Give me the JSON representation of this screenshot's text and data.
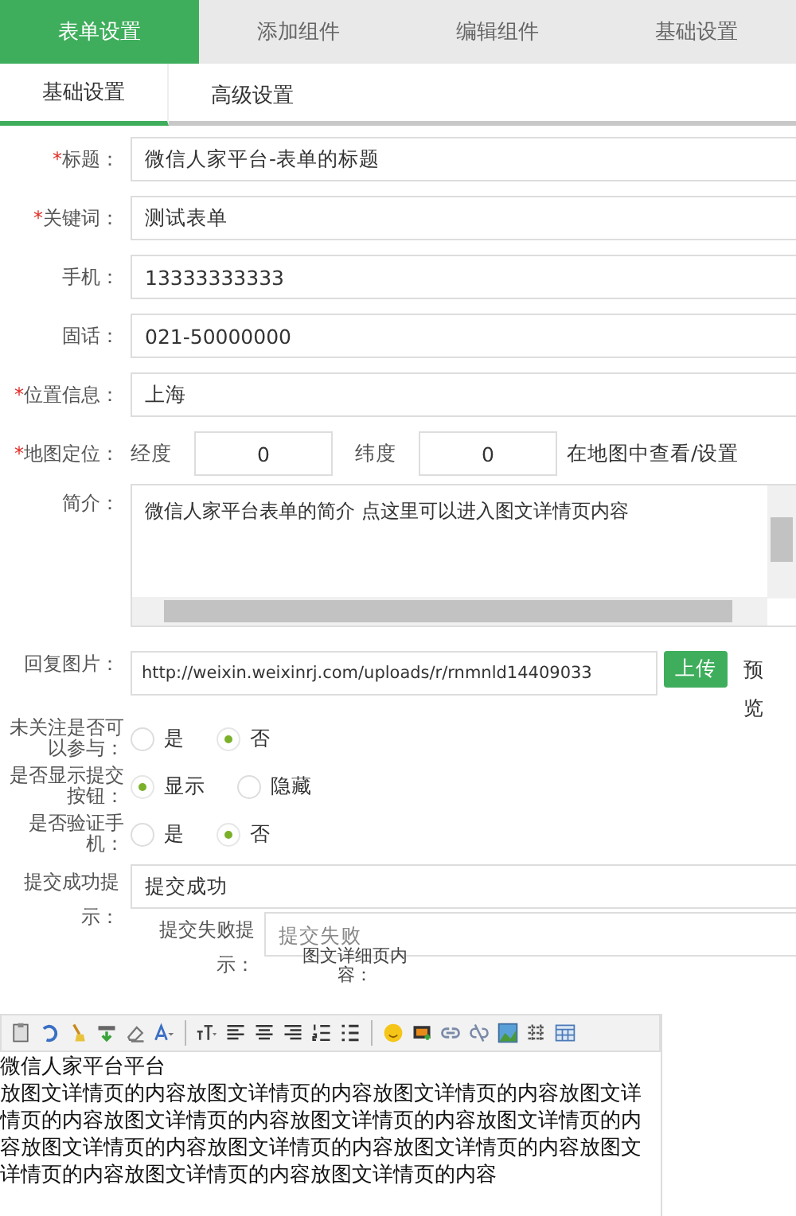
{
  "tabs": [
    {
      "label": "表单设置",
      "selected": true
    },
    {
      "label": "添加组件",
      "selected": false
    },
    {
      "label": "编辑组件",
      "selected": false
    },
    {
      "label": "基础设置",
      "selected": false
    }
  ],
  "subtabs": [
    {
      "label": "基础设置",
      "selected": true
    },
    {
      "label": "高级设置",
      "selected": false
    }
  ],
  "fields": [
    {
      "mark": "*",
      "label": "标题：",
      "value": "微信人家平台-表单的标题"
    },
    {
      "mark": "*",
      "label": "关键词：",
      "value": "测试表单"
    },
    {
      "label": "手机：",
      "value": "13333333333"
    },
    {
      "label": "固话：",
      "value": "021-50000000"
    },
    {
      "mark": "*",
      "label": "位置信息：",
      "value": "上海"
    }
  ],
  "map": {
    "mark": "*",
    "label": "地图定位：",
    "lng_label": "经度",
    "lng": "0",
    "lat_label": "纬度",
    "lat": "0",
    "link": "在地图中查看/设置"
  },
  "intro": {
    "label": "简介：",
    "value": "微信人家平台表单的简介 点这里可以进入图文详情页内容"
  },
  "reply_image": {
    "label": "回复图片：",
    "value": "http://weixin.weixinrj.com/uploads/r/rnmnld14409033",
    "upload": "上传",
    "preview": "预览"
  },
  "radios": [
    {
      "label": "未关注是否可以参与：",
      "options": [
        {
          "label": "是",
          "selected": false
        },
        {
          "label": "否",
          "selected": true
        }
      ]
    },
    {
      "label": "是否显示提交按钮：",
      "options": [
        {
          "label": "显示",
          "selected": true
        },
        {
          "label": "隐藏",
          "selected": false
        }
      ]
    },
    {
      "label": "是否验证手机：",
      "options": [
        {
          "label": "是",
          "selected": false
        },
        {
          "label": "否",
          "selected": true
        }
      ]
    }
  ],
  "success": {
    "label": "提交成功提示：",
    "value": "提交成功"
  },
  "fail": {
    "label": "提交失败提示：",
    "placeholder": "提交失败"
  },
  "detail": {
    "label": "图文详细页内容：",
    "title_line": "微信人家平台平台",
    "body": "放图文详情页的内容放图文详情页的内容放图文详情页的内容放图文详情页的内容放图文详情页的内容放图文详情页的内容放图文详情页的内容放图文详情页的内容放图文详情页的内容放图文详情页的内容放图文详情页的内容放图文详情页的内容放图文详情页的内容"
  }
}
